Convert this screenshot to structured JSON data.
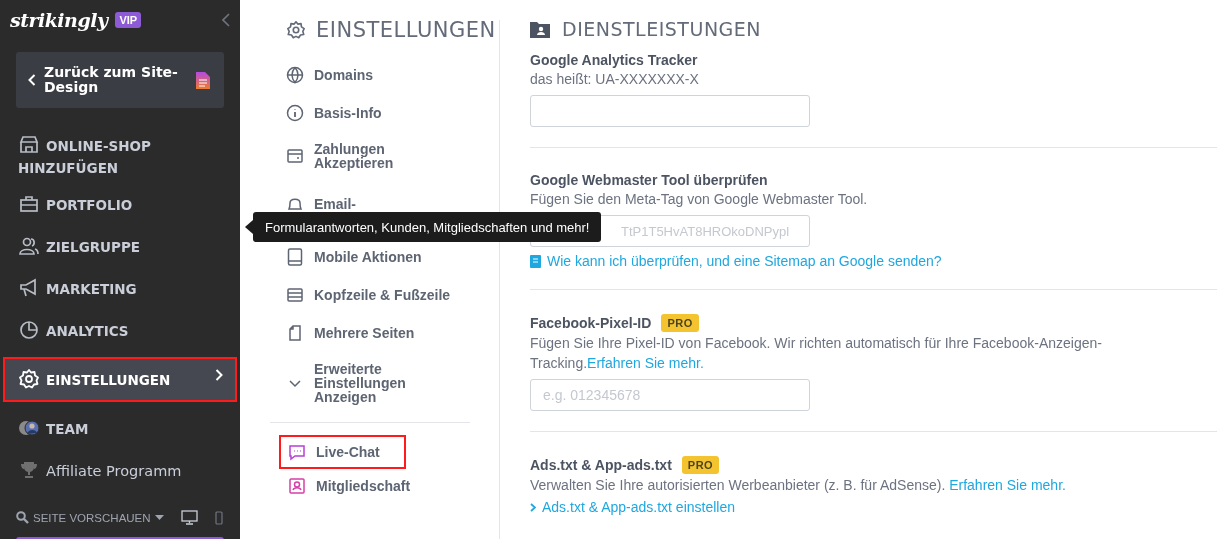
{
  "sidebar": {
    "logo": "strikingly",
    "badge": "VIP",
    "back_button": "Zurück zum Site-Design",
    "items": [
      {
        "label": "ONLINE-SHOP HINZUFÜGEN",
        "kind": "section",
        "selected": false,
        "outlined": false
      },
      {
        "label": "PORTFOLIO",
        "kind": "section",
        "selected": false,
        "outlined": false
      },
      {
        "label": "ZIELGRUPPE",
        "kind": "section",
        "selected": false,
        "outlined": false
      },
      {
        "label": "MARKETING",
        "kind": "section",
        "selected": false,
        "outlined": false
      },
      {
        "label": "ANALYTICS",
        "kind": "section",
        "selected": false,
        "outlined": false
      },
      {
        "label": "EINSTELLUNGEN",
        "kind": "section",
        "selected": true,
        "outlined": true
      },
      {
        "label": "TEAM",
        "kind": "section",
        "selected": false,
        "outlined": false
      },
      {
        "label": "Affiliate Programm",
        "kind": "plain",
        "selected": false,
        "outlined": false
      }
    ],
    "preview": "SEITE VORSCHAUEN"
  },
  "settings_menu": {
    "title": "EINSTELLUNGEN",
    "items": [
      {
        "label": "Domains"
      },
      {
        "label": "Basis-Info"
      },
      {
        "label": "Zahlungen Akzeptieren"
      },
      {
        "label": "Email-"
      },
      {
        "label": "Mobile Aktionen"
      },
      {
        "label": "Kopfzeile & Fußzeile"
      },
      {
        "label": "Mehrere Seiten"
      },
      {
        "label": "Erweiterte Einstellungen Anzeigen"
      }
    ],
    "extra_items": [
      {
        "label": "Live-Chat",
        "outlined": true
      },
      {
        "label": "Mitgliedschaft",
        "outlined": false
      }
    ]
  },
  "tooltip": "Formularantworten, Kunden, Mitgliedschaften und mehr!",
  "services": {
    "title": "DIENSTLEISTUNGEN",
    "sections": [
      {
        "label": "Google Analytics Tracker",
        "description": "das heißt: UA-XXXXXXX-X",
        "has_input": true
      },
      {
        "label": "Google Webmaster Tool überprüfen",
        "description": "Fügen Sie den Meta-Tag von Google Webmaster Tool.",
        "has_input": true,
        "placeholder": "TtP1T5HvAT8HROkoDNPypl",
        "help_link": "Wie kann ich überprüfen, und eine Sitemap an Google senden?"
      },
      {
        "label": "Facebook-Pixel-ID",
        "badge": "PRO",
        "description": "Fügen Sie Ihre Pixel-ID von Facebook. Wir richten automatisch für Ihre Facebook-Anzeigen-Tracking.",
        "link": "Erfahren Sie mehr.",
        "has_input": true,
        "placeholder": "e.g. 012345678"
      },
      {
        "label": "Ads.txt & App-ads.txt",
        "badge": "PRO",
        "description": "Verwalten Sie Ihre autorisierten Werbeanbieter (z. B. für AdSense). ",
        "link": "Erfahren Sie mehr.",
        "expander": "Ads.txt & App-ads.txt einstellen"
      }
    ]
  }
}
